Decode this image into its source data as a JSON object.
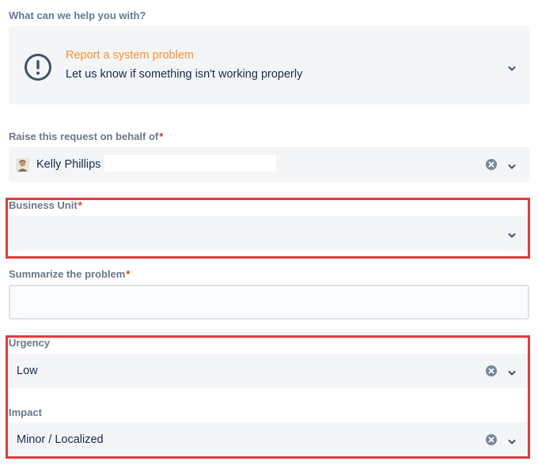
{
  "request_type": {
    "label": "What can we help you with?",
    "title": "Report a system problem",
    "description": "Let us know if something isn't working properly",
    "icon": "exclamation-circle-icon"
  },
  "on_behalf": {
    "label": "Raise this request on behalf of",
    "required_mark": "*",
    "value": "Kelly Phillips"
  },
  "business_unit": {
    "label": "Business Unit",
    "required_mark": "*",
    "value": ""
  },
  "summary": {
    "label": "Summarize the problem",
    "required_mark": "*",
    "value": ""
  },
  "urgency": {
    "label": "Urgency",
    "value": "Low"
  },
  "impact": {
    "label": "Impact",
    "value": "Minor / Localized"
  },
  "colors": {
    "accent_orange": "#f79233",
    "required_red": "#de350b",
    "highlight_red": "#e5393d",
    "field_bg": "#f4f5f7",
    "label_gray": "#6b778c"
  }
}
